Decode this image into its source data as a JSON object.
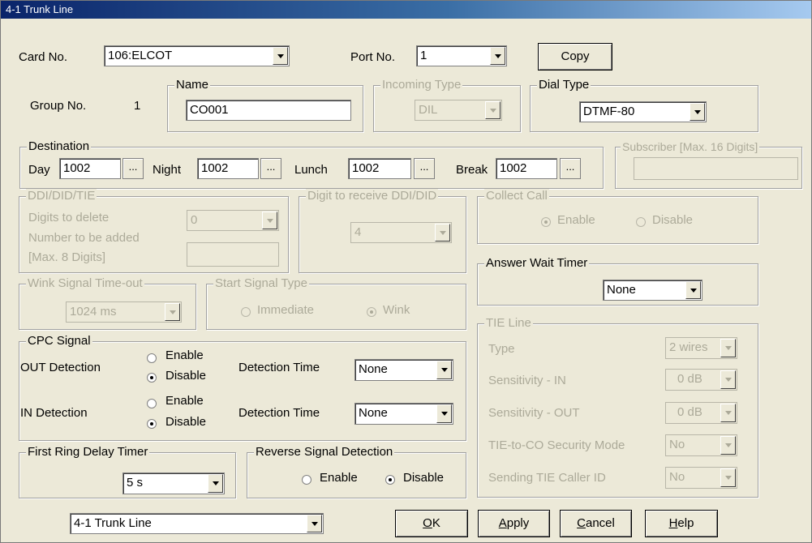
{
  "window": {
    "title": "4-1 Trunk Line"
  },
  "card": {
    "label": "Card No.",
    "value": "106:ELCOT"
  },
  "port": {
    "label": "Port No.",
    "value": "1"
  },
  "copy_button": {
    "label": "Copy"
  },
  "group": {
    "label": "Group No.",
    "value": "1"
  },
  "name": {
    "legend": "Name",
    "value": "CO001"
  },
  "incoming_type": {
    "legend": "Incoming Type",
    "value": "DIL"
  },
  "dial_type": {
    "legend": "Dial Type",
    "value": "DTMF-80"
  },
  "destination": {
    "legend": "Destination",
    "day": {
      "label": "Day",
      "value": "1002"
    },
    "night": {
      "label": "Night",
      "value": "1002"
    },
    "lunch": {
      "label": "Lunch",
      "value": "1002"
    },
    "break": {
      "label": "Break",
      "value": "1002"
    },
    "browse_label": "..."
  },
  "subscriber": {
    "legend": "Subscriber [Max. 16 Digits]",
    "value": ""
  },
  "ddi": {
    "legend": "DDI/DID/TIE",
    "digits_label": "Digits to delete",
    "digits_value": "0",
    "number_label_1": "Number to be added",
    "number_label_2": "[Max. 8 Digits]",
    "number_value": ""
  },
  "digit_receive": {
    "legend": "Digit to receive DDI/DID",
    "value": "4"
  },
  "collect_call": {
    "legend": "Collect Call",
    "enable": "Enable",
    "disable": "Disable",
    "selected": "Enable"
  },
  "answer_wait": {
    "legend": "Answer Wait Timer",
    "value": "None"
  },
  "wink": {
    "legend": "Wink Signal Time-out",
    "value": "1024 ms"
  },
  "start_signal": {
    "legend": "Start Signal Type",
    "immediate": "Immediate",
    "wink": "Wink",
    "selected": "Wink"
  },
  "cpc": {
    "legend": "CPC Signal",
    "out_label": "OUT Detection",
    "in_label": "IN Detection",
    "enable": "Enable",
    "disable": "Disable",
    "out_selected": "Disable",
    "in_selected": "Disable",
    "detection_time_label": "Detection Time",
    "out_time": "None",
    "in_time": "None"
  },
  "tie_line": {
    "legend": "TIE Line",
    "type": {
      "label": "Type",
      "value": "2 wires"
    },
    "sens_in": {
      "label": "Sensitivity - IN",
      "value": "0 dB"
    },
    "sens_out": {
      "label": "Sensitivity - OUT",
      "value": "0 dB"
    },
    "security": {
      "label": "TIE-to-CO Security Mode",
      "value": "No"
    },
    "caller_id": {
      "label": "Sending TIE Caller ID",
      "value": "No"
    }
  },
  "first_ring": {
    "legend": "First Ring Delay Timer",
    "value": "5 s"
  },
  "reverse": {
    "legend": "Reverse Signal Detection",
    "enable": "Enable",
    "disable": "Disable",
    "selected": "Disable"
  },
  "footer": {
    "screen_select": "4-1 Trunk Line",
    "ok": {
      "mnemonic": "O",
      "rest": "K"
    },
    "apply": {
      "mnemonic": "A",
      "rest": "pply"
    },
    "cancel": {
      "mnemonic": "C",
      "rest": "ancel"
    },
    "help": {
      "mnemonic": "H",
      "rest": "elp"
    }
  }
}
